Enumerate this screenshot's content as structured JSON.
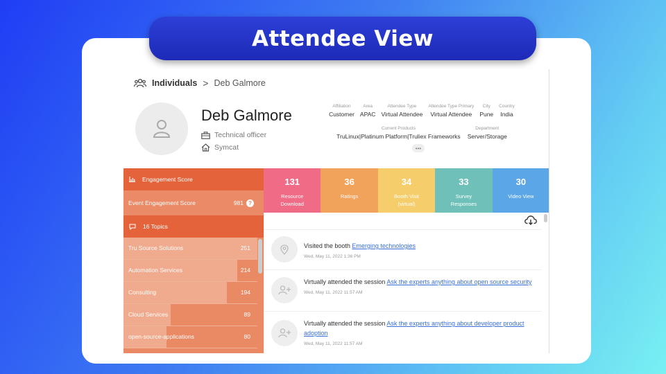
{
  "slide": {
    "title": "Attendee View"
  },
  "breadcrumb": {
    "root": "Individuals",
    "separator": ">",
    "current": "Deb Galmore"
  },
  "profile": {
    "name": "Deb Galmore",
    "title": "Technical officer",
    "company": "Symcat",
    "attributes_row1": [
      {
        "label": "Affiliation",
        "value": "Customer"
      },
      {
        "label": "Area",
        "value": "APAC"
      },
      {
        "label": "Attendee Type",
        "value": "Virtual Attendee"
      },
      {
        "label": "Attendee Type Primary",
        "value": "Virtual Attendee"
      },
      {
        "label": "City",
        "value": "Pune"
      },
      {
        "label": "Country",
        "value": "India"
      }
    ],
    "attributes_row2": [
      {
        "label": "Current Products",
        "value": "TruLinux|Platinum Platform|Truliex Frameworks"
      },
      {
        "label": "Department",
        "value": "Server/Storage"
      }
    ],
    "more_label": "•••"
  },
  "engagement": {
    "header": "Engagement Score",
    "event_label": "Event Engagement Score",
    "event_value": "981",
    "help_glyph": "?"
  },
  "topics": {
    "header": "16 Topics",
    "items": [
      {
        "label": "Tru Source Solutions",
        "value": "251",
        "fill": 1.0
      },
      {
        "label": "Automation Services",
        "value": "214",
        "fill": 0.85
      },
      {
        "label": "Consulting",
        "value": "194",
        "fill": 0.77
      },
      {
        "label": "Cloud Services",
        "value": "89",
        "fill": 0.35
      },
      {
        "label": "open-source-applications",
        "value": "80",
        "fill": 0.32
      }
    ]
  },
  "stats": [
    {
      "value": "131",
      "label_line1": "Resource",
      "label_line2": "Download",
      "color": "#ef6b86"
    },
    {
      "value": "36",
      "label_line1": "Ratings",
      "label_line2": "",
      "color": "#f1a35c"
    },
    {
      "value": "34",
      "label_line1": "Booth Visit",
      "label_line2": "(virtual)",
      "color": "#f5cd6a"
    },
    {
      "value": "33",
      "label_line1": "Survey",
      "label_line2": "Responses",
      "color": "#6fc0b8"
    },
    {
      "value": "30",
      "label_line1": "Video View",
      "label_line2": "",
      "color": "#5aa6e6"
    }
  ],
  "activity": [
    {
      "icon": "location-pin-icon",
      "text": "Visited the booth ",
      "link": "Emerging technologies",
      "date": "Wed, May 11, 2022 1:36 PM"
    },
    {
      "icon": "add-person-icon",
      "text": "Virtually attended the session ",
      "link": "Ask the experts anything about open source security",
      "date": "Wed, May 11, 2022 11:57 AM"
    },
    {
      "icon": "add-person-icon",
      "text": "Virtually attended the session ",
      "link": "Ask the experts anything about developer product adoption",
      "date": "Wed, May 11, 2022 11:57 AM"
    }
  ],
  "colors": {
    "header_orange": "#e5633b",
    "panel_orange": "#e98a65",
    "bar_light": "#f0aa8d",
    "link": "#3a6fd8"
  }
}
